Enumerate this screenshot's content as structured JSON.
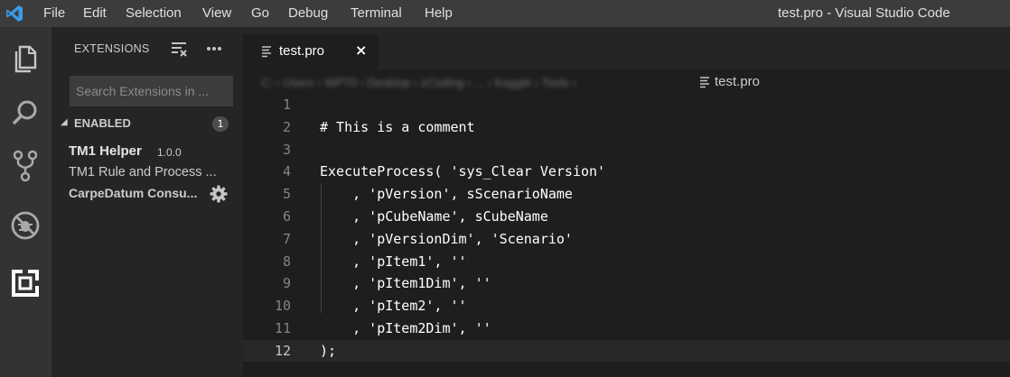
{
  "titlebar": {
    "menu": [
      "File",
      "Edit",
      "Selection",
      "View",
      "Go",
      "Debug",
      "Terminal",
      "Help"
    ],
    "window_title": "test.pro - Visual Studio Code"
  },
  "activitybar": {
    "icons": [
      "explorer-icon",
      "search-icon",
      "source-control-icon",
      "debug-icon",
      "extensions-icon"
    ]
  },
  "sidebar": {
    "title": "EXTENSIONS",
    "search_placeholder": "Search Extensions in ...",
    "section_label": "ENABLED",
    "section_count": "1",
    "extension": {
      "name": "TM1 Helper",
      "version": "1.0.0",
      "description": "TM1 Rule and Process ...",
      "publisher": "CarpeDatum Consu..."
    }
  },
  "editor": {
    "tab_label": "test.pro",
    "tab_close": "×",
    "breadcrumb_blurred": "C: › Users › WPT0 › Desktop › zCoding › ... › Kaggle › Tools ›",
    "breadcrumb_file": "test.pro",
    "lines": [
      {
        "n": "1",
        "text": ""
      },
      {
        "n": "2",
        "text": "# This is a comment"
      },
      {
        "n": "3",
        "text": ""
      },
      {
        "n": "4",
        "text": "ExecuteProcess( 'sys_Clear Version'"
      },
      {
        "n": "5",
        "text": "    , 'pVersion', sScenarioName"
      },
      {
        "n": "6",
        "text": "    , 'pCubeName', sCubeName"
      },
      {
        "n": "7",
        "text": "    , 'pVersionDim', 'Scenario'"
      },
      {
        "n": "8",
        "text": "    , 'pItem1', ''"
      },
      {
        "n": "9",
        "text": "    , 'pItem1Dim', ''"
      },
      {
        "n": "10",
        "text": "    , 'pItem2', ''"
      },
      {
        "n": "11",
        "text": "    , 'pItem2Dim', ''"
      },
      {
        "n": "12",
        "text": ");"
      }
    ],
    "active_line": "12"
  }
}
